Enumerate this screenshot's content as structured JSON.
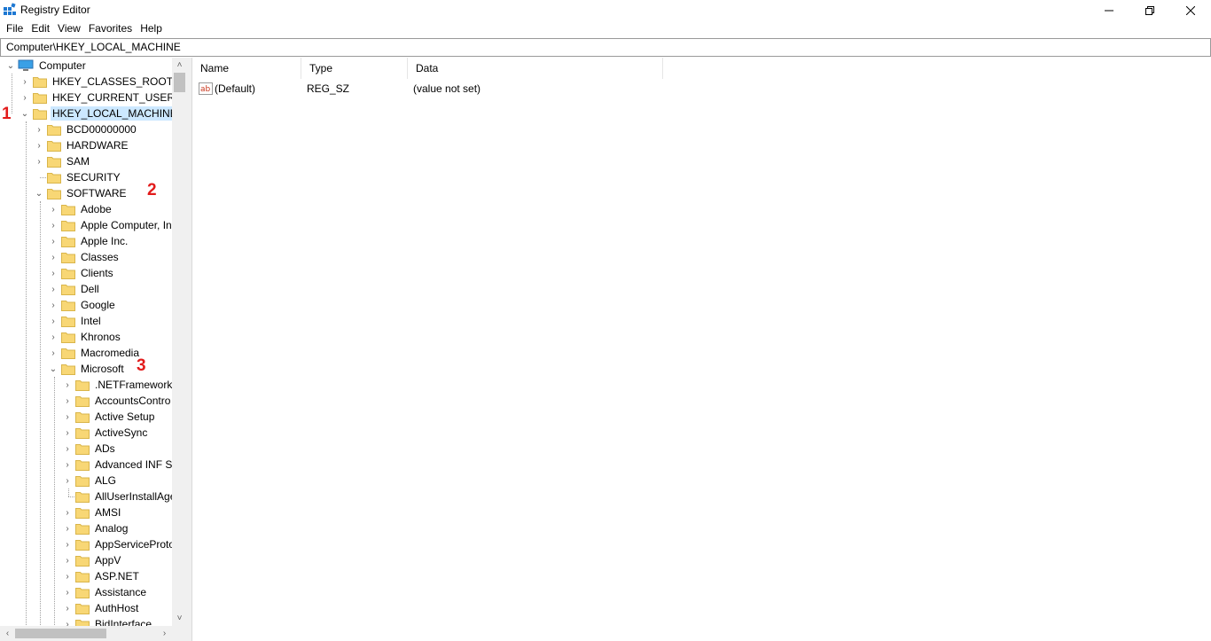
{
  "window": {
    "title": "Registry Editor",
    "icon": "registry-editor-icon"
  },
  "menu": [
    "File",
    "Edit",
    "View",
    "Favorites",
    "Help"
  ],
  "address": "Computer\\HKEY_LOCAL_MACHINE",
  "tree": {
    "root": "Computer",
    "hives": [
      "HKEY_CLASSES_ROOT",
      "HKEY_CURRENT_USER",
      "HKEY_LOCAL_MACHINE"
    ],
    "hklm_children": [
      "BCD00000000",
      "HARDWARE",
      "SAM",
      "SECURITY",
      "SOFTWARE"
    ],
    "software_children": [
      "Adobe",
      "Apple Computer, In",
      "Apple Inc.",
      "Classes",
      "Clients",
      "Dell",
      "Google",
      "Intel",
      "Khronos",
      "Macromedia",
      "Microsoft"
    ],
    "microsoft_children": [
      ".NETFramework",
      "AccountsContro",
      "Active Setup",
      "ActiveSync",
      "ADs",
      "Advanced INF Se",
      "ALG",
      "AllUserInstallAge",
      "AMSI",
      "Analog",
      "AppServiceProto",
      "AppV",
      "ASP.NET",
      "Assistance",
      "AuthHost",
      "BidInterface"
    ]
  },
  "callouts": [
    "1",
    "2",
    "3"
  ],
  "list": {
    "columns": [
      "Name",
      "Type",
      "Data"
    ],
    "rows": [
      {
        "name": "(Default)",
        "type": "REG_SZ",
        "data": "(value not set)"
      }
    ]
  },
  "colors": {
    "selection": "#cce8ff",
    "callout": "#e21b1b",
    "folder": "#f8d775"
  }
}
